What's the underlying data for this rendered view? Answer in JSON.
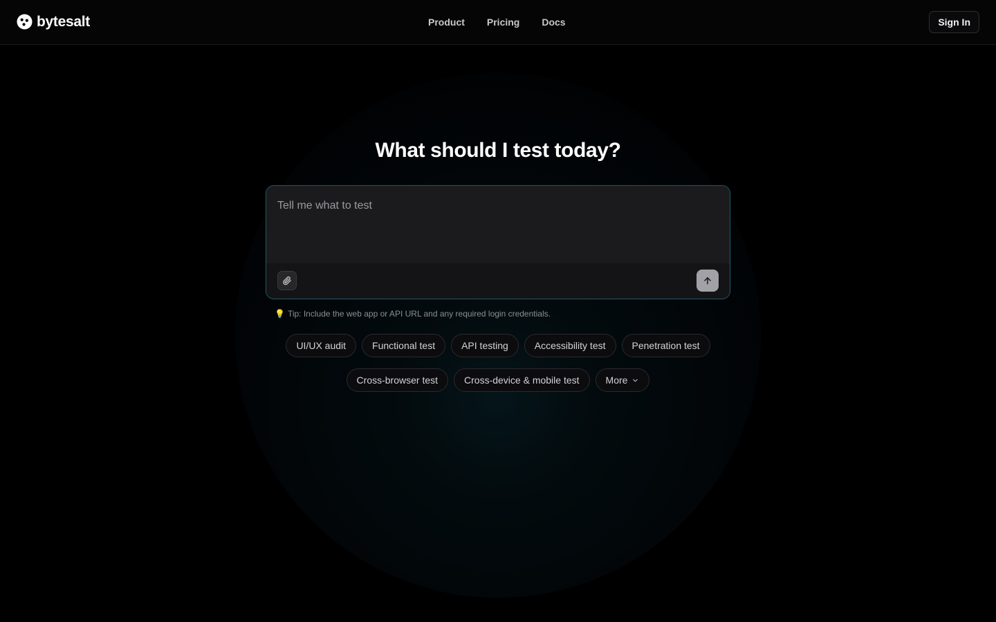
{
  "brand": {
    "name": "bytesalt",
    "logo_icon": "bytesalt-logo-icon"
  },
  "nav": {
    "items": [
      "Product",
      "Pricing",
      "Docs"
    ]
  },
  "header": {
    "sign_in_label": "Sign In"
  },
  "hero": {
    "title": "What should I test today?"
  },
  "composer": {
    "placeholder": "Tell me what to test",
    "value": "",
    "attach_icon": "paperclip-icon",
    "send_icon": "arrow-up-icon"
  },
  "tip": {
    "icon": "lightbulb-icon",
    "text": "Tip: Include the web app or API URL and any required login credentials."
  },
  "suggestions": {
    "row1": [
      "UI/UX audit",
      "Functional test",
      "API testing",
      "Accessibility test",
      "Penetration test"
    ],
    "row2": [
      "Cross-browser test",
      "Cross-device & mobile test"
    ],
    "more_label": "More",
    "more_icon": "chevron-down-icon"
  },
  "colors": {
    "background": "#000000",
    "accent_border": "#1f5560",
    "send_button": "#a1a1a6"
  }
}
